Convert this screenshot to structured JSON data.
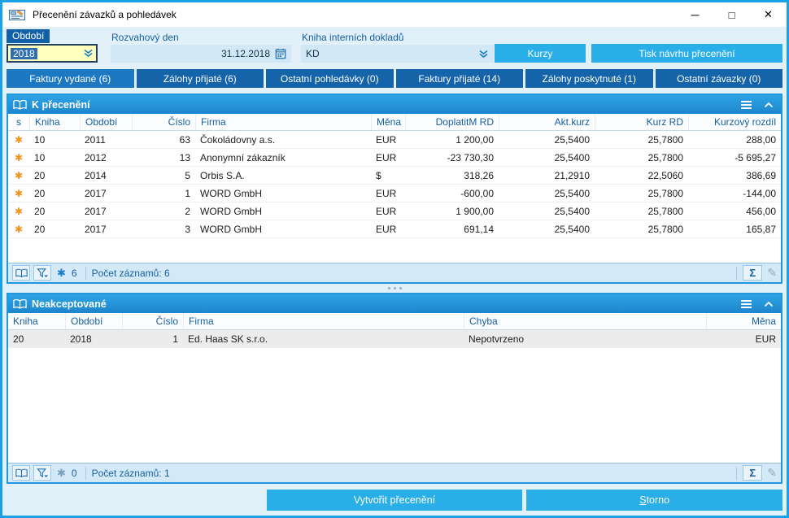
{
  "window": {
    "title": "Přecenění závazků a pohledávek",
    "controls": {
      "minimize": "─",
      "maximize": "□",
      "close": "✕"
    }
  },
  "icons": {
    "row_marker": "✱",
    "marked_filter": "✱",
    "sum": "Σ",
    "edit": "✎"
  },
  "toolbar": {
    "period": {
      "label": "Období",
      "value": "2018"
    },
    "balance_day": {
      "label": "Rozvahový den",
      "value": "31.12.2018"
    },
    "internal_book": {
      "label": "Kniha interních dokladů",
      "value": "KD"
    },
    "rates_button": "Kurzy",
    "print_button": "Tisk návrhu přecenění"
  },
  "tabs": [
    {
      "label": "Faktury vydané (6)"
    },
    {
      "label": "Zálohy přijaté (6)"
    },
    {
      "label": "Ostatní pohledávky (0)"
    },
    {
      "label": "Faktury přijaté (14)"
    },
    {
      "label": "Zálohy poskytnuté (1)"
    },
    {
      "label": "Ostatní závazky (0)"
    }
  ],
  "panel1": {
    "title": "K přecenění",
    "columns": {
      "s": "s",
      "kniha": "Kniha",
      "obdobi": "Období",
      "cislo": "Číslo",
      "firma": "Firma",
      "mena": "Měna",
      "doplatit": "DoplatitM RD",
      "akt": "Akt.kurz",
      "rd": "Kurz RD",
      "rozdil": "Kurzový rozdíl"
    },
    "rows": [
      {
        "kniha": "10",
        "obdobi": "2011",
        "cislo": "63",
        "firma": "Čokoládovny a.s.",
        "mena": "EUR",
        "doplatit": "1 200,00",
        "akt": "25,5400",
        "rd": "25,7800",
        "rozdil": "288,00"
      },
      {
        "kniha": "10",
        "obdobi": "2012",
        "cislo": "13",
        "firma": "Anonymní zákazník",
        "mena": "EUR",
        "doplatit": "-23 730,30",
        "akt": "25,5400",
        "rd": "25,7800",
        "rozdil": "-5 695,27"
      },
      {
        "kniha": "20",
        "obdobi": "2014",
        "cislo": "5",
        "firma": "Orbis S.A.",
        "mena": "$",
        "doplatit": "318,26",
        "akt": "21,2910",
        "rd": "22,5060",
        "rozdil": "386,69"
      },
      {
        "kniha": "20",
        "obdobi": "2017",
        "cislo": "1",
        "firma": "WORD GmbH",
        "mena": "EUR",
        "doplatit": "-600,00",
        "akt": "25,5400",
        "rd": "25,7800",
        "rozdil": "-144,00"
      },
      {
        "kniha": "20",
        "obdobi": "2017",
        "cislo": "2",
        "firma": "WORD GmbH",
        "mena": "EUR",
        "doplatit": "1 900,00",
        "akt": "25,5400",
        "rd": "25,7800",
        "rozdil": "456,00"
      },
      {
        "kniha": "20",
        "obdobi": "2017",
        "cislo": "3",
        "firma": "WORD GmbH",
        "mena": "EUR",
        "doplatit": "691,14",
        "akt": "25,5400",
        "rd": "25,7800",
        "rozdil": "165,87"
      }
    ],
    "footer": {
      "marked_count": "6",
      "records": "Počet záznamů: 6"
    }
  },
  "panel2": {
    "title": "Neakceptované",
    "columns": {
      "kniha": "Kniha",
      "obdobi": "Období",
      "cislo": "Číslo",
      "firma": "Firma",
      "chyba": "Chyba",
      "mena": "Měna"
    },
    "rows": [
      {
        "kniha": "20",
        "obdobi": "2018",
        "cislo": "1",
        "firma": "Ed. Haas SK s.r.o.",
        "chyba": "Nepotvrzeno",
        "mena": "EUR"
      }
    ],
    "footer": {
      "marked_count": "0",
      "records": "Počet záznamů: 1"
    }
  },
  "actions": {
    "create": "Vytvořit přecenění",
    "cancel": "Storno"
  }
}
